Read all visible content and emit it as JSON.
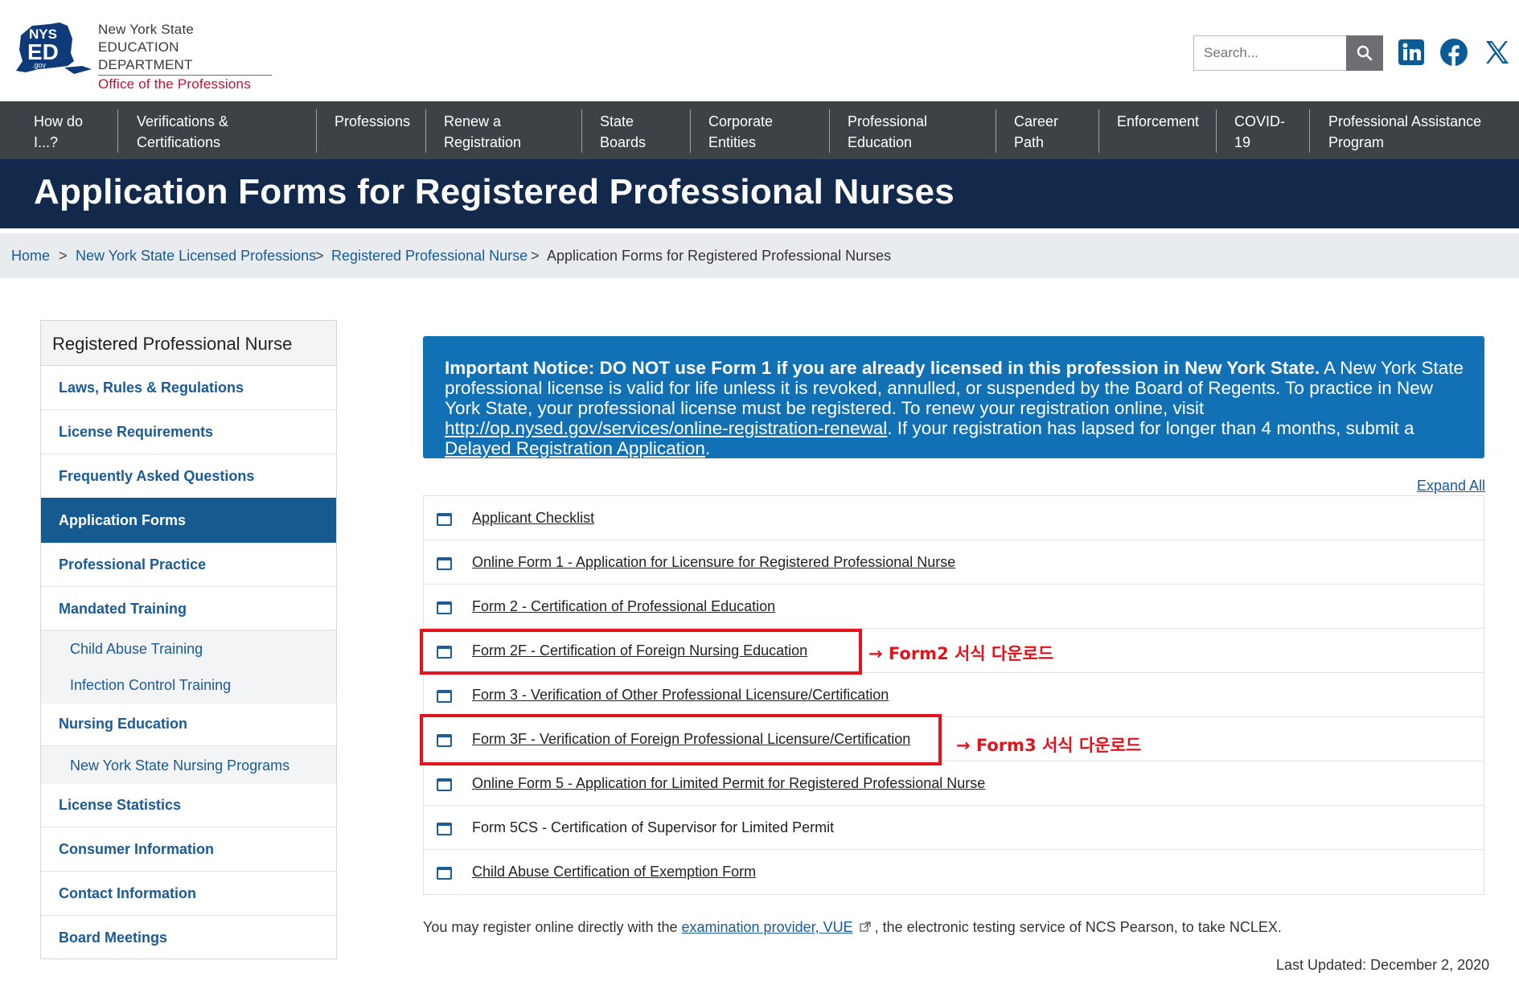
{
  "header": {
    "logo": {
      "badge_top": "NYS",
      "badge_mid": "ED",
      "badge_sub": ".gov",
      "line1": "New York State",
      "line2": "EDUCATION DEPARTMENT",
      "line3": "Office of the Professions"
    },
    "search": {
      "placeholder": "Search...",
      "icon": "search-icon"
    },
    "social": [
      {
        "name": "linkedin-icon"
      },
      {
        "name": "facebook-icon"
      },
      {
        "name": "x-icon"
      }
    ]
  },
  "nav": {
    "items": [
      {
        "l1": "How do",
        "l2": "I...?"
      },
      {
        "l1": "Verifications &",
        "l2": "Certifications"
      },
      {
        "l1": "Professions",
        "l2": ""
      },
      {
        "l1": "Renew a",
        "l2": "Registration"
      },
      {
        "l1": "State",
        "l2": "Boards"
      },
      {
        "l1": "Corporate",
        "l2": "Entities"
      },
      {
        "l1": "Professional",
        "l2": "Education"
      },
      {
        "l1": "Career",
        "l2": "Path"
      },
      {
        "l1": "Enforcement",
        "l2": ""
      },
      {
        "l1": "COVID-",
        "l2": "19"
      },
      {
        "l1": "Professional Assistance",
        "l2": "Program"
      }
    ]
  },
  "page": {
    "title": "Application Forms for Registered Professional Nurses"
  },
  "breadcrumb": {
    "sep": ">",
    "items": [
      "Home",
      "New York State Licensed Professions",
      "Registered Professional Nurse"
    ],
    "current": "Application Forms for Registered Professional Nurses"
  },
  "sidebar": {
    "title": "Registered Professional Nurse",
    "items": [
      "Laws, Rules & Regulations",
      "License Requirements",
      "Frequently Asked Questions",
      "Application Forms",
      "Professional Practice",
      "Mandated Training",
      "Child Abuse Training",
      "Infection Control Training",
      "Nursing Education",
      "New York State Nursing Programs",
      "License Statistics",
      "Consumer Information",
      "Contact Information",
      "Board Meetings"
    ]
  },
  "notice": {
    "bold": "Important Notice: DO NOT use Form 1 if you are already licensed in this profession in New York State.",
    "text1": " A New York State professional license is valid for life unless it is revoked, annulled, or suspended by the Board of Regents. To practice in New York State, your professional license must be registered. To renew your registration online, visit ",
    "link1": "http://op.nysed.gov/services/online-registration-renewal",
    "text2": ". If your registration has lapsed for longer than 4 months, submit a ",
    "link2": "Delayed Registration Application",
    "text3": "."
  },
  "expand_all": "Expand All",
  "forms": [
    "Applicant Checklist",
    "Online Form 1 - Application for Licensure for Registered Professional Nurse",
    "Form 2 - Certification of Professional Education",
    "Form 2F - Certification of Foreign Nursing Education",
    "Form 3 - Verification of Other Professional Licensure/Certification",
    "Form 3F - Verification of Foreign Professional Licensure/Certification",
    "Online Form 5 - Application for Limited Permit for Registered Professional Nurse",
    "Form 5CS - Certification of Supervisor for Limited Permit",
    "Child Abuse Certification of Exemption Form"
  ],
  "annotations": {
    "note1": "→ Form2 서식 다운로드",
    "note2": "→ Form3 서식 다운로드",
    "color": "#e2131b"
  },
  "footer": {
    "text1": "You may register online directly with the ",
    "link": "examination provider, VUE",
    "text2": " , the electronic testing service of NCS Pearson, to take NCLEX.",
    "updated": "Last Updated: December 2, 2020"
  }
}
